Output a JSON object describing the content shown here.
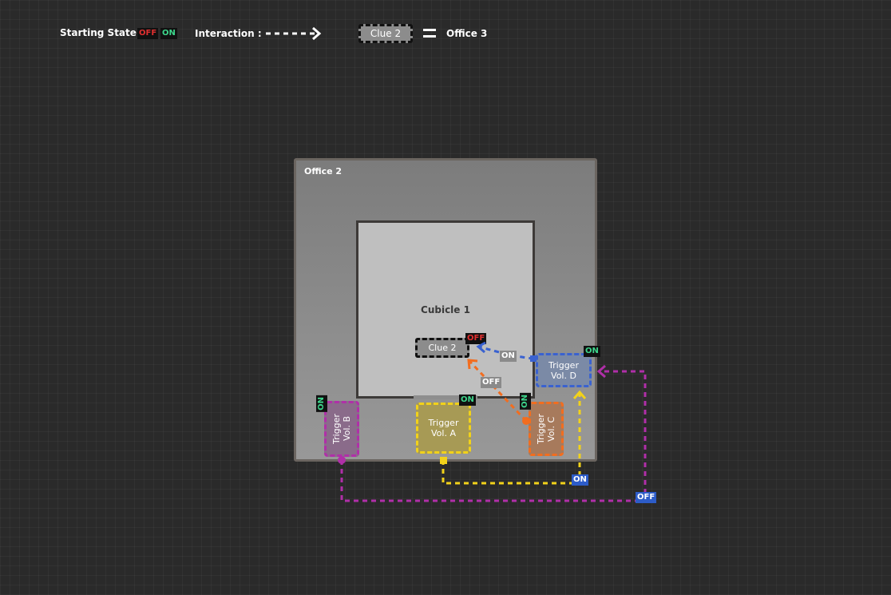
{
  "legend": {
    "starting_state_label": "Starting State :",
    "off": "OFF",
    "on": "ON",
    "interaction_label": "Interaction :",
    "clue_label": "Clue 2",
    "equals_target": "Office 3"
  },
  "office": {
    "label": "Office 2"
  },
  "cubicle": {
    "label": "Cubicle 1"
  },
  "clue": {
    "label": "Clue 2",
    "state": "OFF"
  },
  "triggers": {
    "a": {
      "label": "Trigger Vol. A",
      "state": "ON"
    },
    "b": {
      "label": "Trigger Vol. B",
      "state": "ON"
    },
    "c": {
      "label": "Trigger Vol. C",
      "state": "ON"
    },
    "d": {
      "label": "Trigger Vol. D",
      "state": "ON"
    }
  },
  "interactions": {
    "d_to_clue": "ON",
    "c_to_clue": "OFF",
    "a_to_d": "ON",
    "b_to_d": "OFF"
  },
  "colors": {
    "trigger_a": "#f2d21a",
    "trigger_b": "#b02fa8",
    "trigger_c": "#f26d1f",
    "trigger_d": "#3a62d0",
    "off_red": "#e03030",
    "on_green": "#3dd68c"
  }
}
